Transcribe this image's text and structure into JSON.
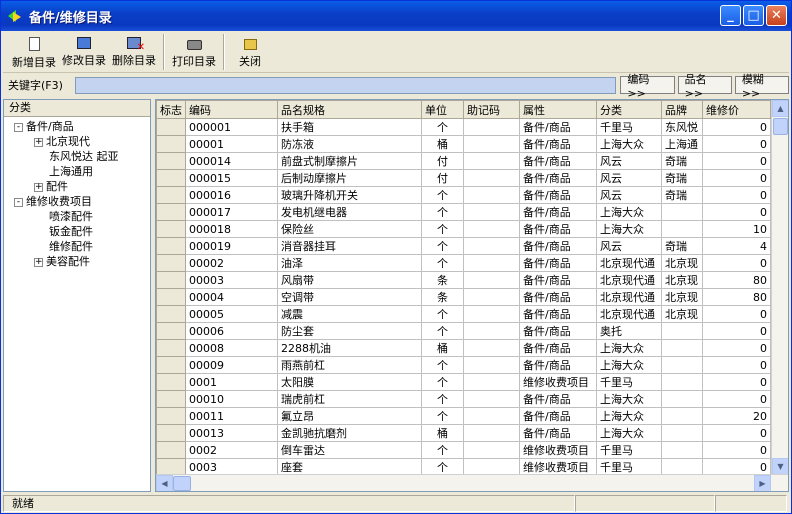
{
  "window": {
    "title": "备件/维修目录",
    "controls": [
      "minimize-icon",
      "maximize-icon",
      "close-icon"
    ]
  },
  "toolbar": {
    "new_label": "新增目录",
    "edit_label": "修改目录",
    "delete_label": "删除目录",
    "print_label": "打印目录",
    "close_label": "关闭"
  },
  "search": {
    "label": "关键字(F3)",
    "value": "",
    "btn_code": "编码>>",
    "btn_name": "品名>>",
    "btn_fuzzy": "模糊>>"
  },
  "tree": {
    "header": "分类",
    "nodes": [
      {
        "level": 0,
        "toggle": "-",
        "label": "备件/商品"
      },
      {
        "level": 1,
        "toggle": "+",
        "label": "北京现代"
      },
      {
        "level": 1,
        "toggle": "",
        "label": "东风悦达 起亚"
      },
      {
        "level": 1,
        "toggle": "",
        "label": "上海通用"
      },
      {
        "level": 1,
        "toggle": "+",
        "label": "配件"
      },
      {
        "level": 0,
        "toggle": "-",
        "label": "维修收费项目"
      },
      {
        "level": 1,
        "toggle": "",
        "label": "喷漆配件"
      },
      {
        "level": 1,
        "toggle": "",
        "label": "钣金配件"
      },
      {
        "level": 1,
        "toggle": "",
        "label": "维修配件"
      },
      {
        "level": 1,
        "toggle": "+",
        "label": "美容配件"
      }
    ]
  },
  "table": {
    "columns": [
      "标志",
      "编码",
      "品名规格",
      "单位",
      "助记码",
      "属性",
      "分类",
      "品牌",
      "维修价"
    ],
    "rows": [
      [
        "",
        "000001",
        "扶手箱",
        "个",
        "",
        "备件/商品",
        "千里马",
        "东风悦",
        "0"
      ],
      [
        "",
        "00001",
        "防冻液",
        "桶",
        "",
        "备件/商品",
        "上海大众",
        "上海通",
        "0"
      ],
      [
        "",
        "000014",
        "前盘式制摩擦片",
        "付",
        "",
        "备件/商品",
        "风云",
        "奇瑞",
        "0"
      ],
      [
        "",
        "000015",
        "后制动摩擦片",
        "付",
        "",
        "备件/商品",
        "风云",
        "奇瑞",
        "0"
      ],
      [
        "",
        "000016",
        "玻璃升降机开关",
        "个",
        "",
        "备件/商品",
        "风云",
        "奇瑞",
        "0"
      ],
      [
        "",
        "000017",
        "发电机继电器",
        "个",
        "",
        "备件/商品",
        "上海大众",
        "",
        "0"
      ],
      [
        "",
        "000018",
        "保险丝",
        "个",
        "",
        "备件/商品",
        "上海大众",
        "",
        "10"
      ],
      [
        "",
        "000019",
        "消音器挂耳",
        "个",
        "",
        "备件/商品",
        "风云",
        "奇瑞",
        "4"
      ],
      [
        "",
        "00002",
        "油泽",
        "个",
        "",
        "备件/商品",
        "北京现代通",
        "北京现",
        "0"
      ],
      [
        "",
        "00003",
        "风扇带",
        "条",
        "",
        "备件/商品",
        "北京现代通",
        "北京现",
        "80"
      ],
      [
        "",
        "00004",
        "空调带",
        "条",
        "",
        "备件/商品",
        "北京现代通",
        "北京现",
        "80"
      ],
      [
        "",
        "00005",
        "减震",
        "个",
        "",
        "备件/商品",
        "北京现代通",
        "北京现",
        "0"
      ],
      [
        "",
        "00006",
        "防尘套",
        "个",
        "",
        "备件/商品",
        "奥托",
        "",
        "0"
      ],
      [
        "",
        "00008",
        "2288机油",
        "桶",
        "",
        "备件/商品",
        "上海大众",
        "",
        "0"
      ],
      [
        "",
        "00009",
        "雨燕前杠",
        "个",
        "",
        "备件/商品",
        "上海大众",
        "",
        "0"
      ],
      [
        "",
        "0001",
        "太阳膜",
        "个",
        "",
        "维修收费项目",
        "千里马",
        "",
        "0"
      ],
      [
        "",
        "00010",
        "瑞虎前杠",
        "个",
        "",
        "备件/商品",
        "上海大众",
        "",
        "0"
      ],
      [
        "",
        "00011",
        "氟立昂",
        "个",
        "",
        "备件/商品",
        "上海大众",
        "",
        "20"
      ],
      [
        "",
        "00013",
        "金凯驰抗磨剂",
        "桶",
        "",
        "备件/商品",
        "上海大众",
        "",
        "0"
      ],
      [
        "",
        "0002",
        "倒车雷达",
        "个",
        "",
        "维修收费项目",
        "千里马",
        "",
        "0"
      ],
      [
        "",
        "0003",
        "座套",
        "个",
        "",
        "维修收费项目",
        "千里马",
        "",
        "0"
      ]
    ]
  },
  "status": {
    "text": "就绪"
  }
}
